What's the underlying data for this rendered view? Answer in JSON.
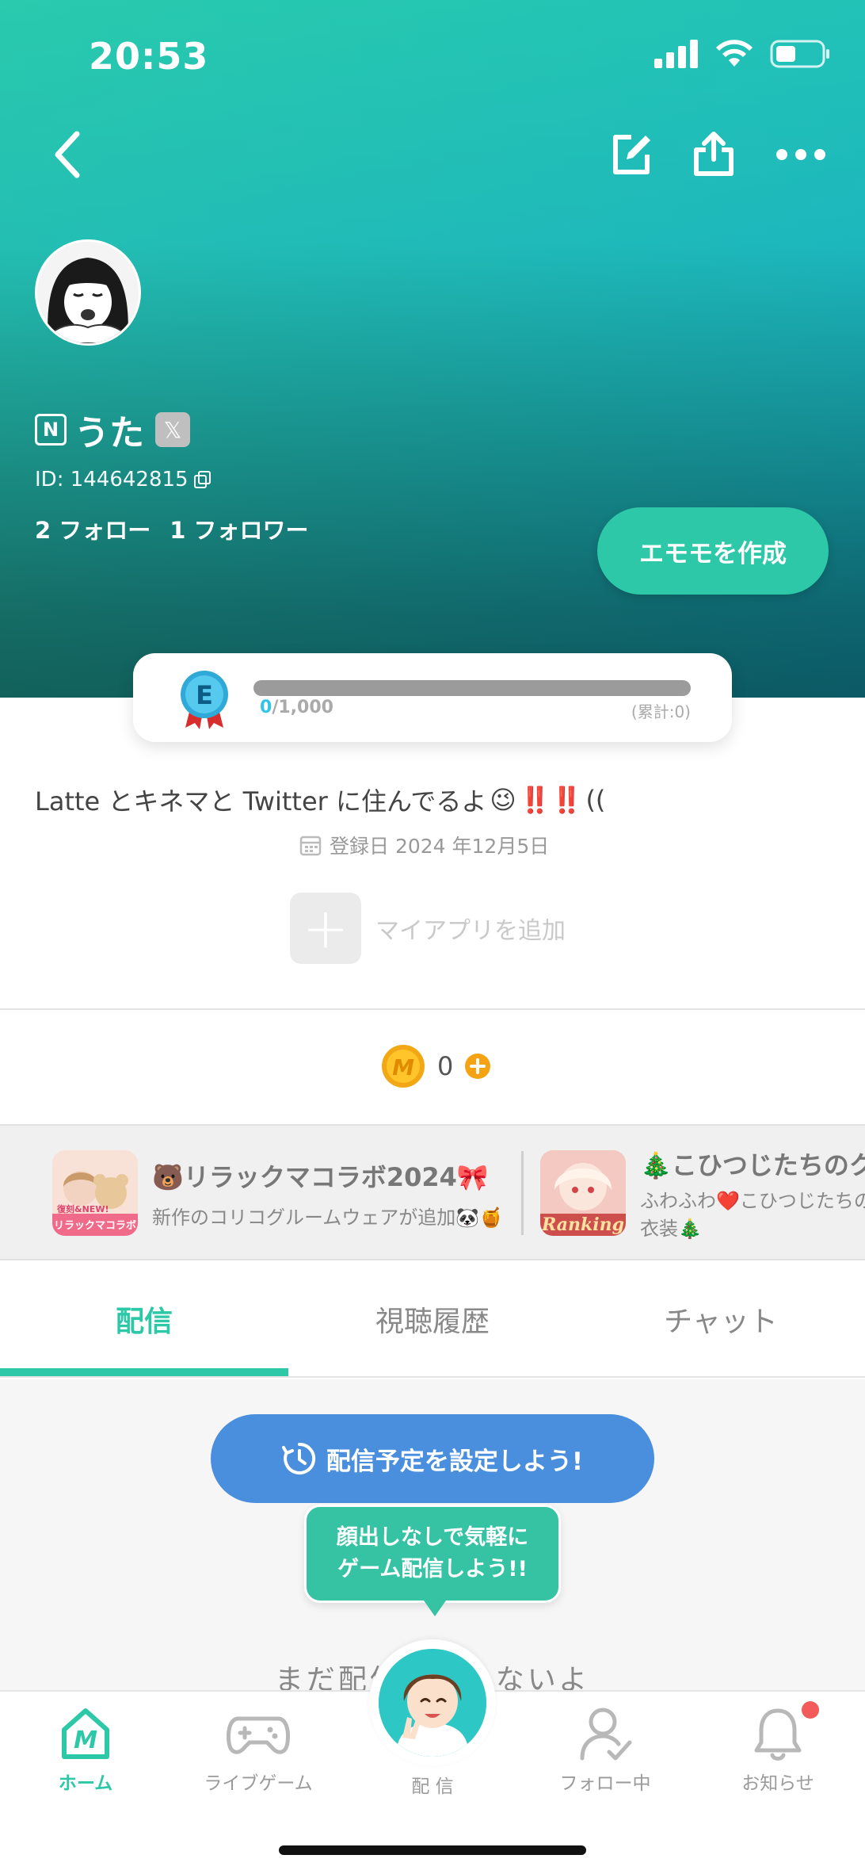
{
  "status_bar": {
    "time": "20:53"
  },
  "profile": {
    "name_badge": "N",
    "name": "うた",
    "x_badge": "𝕏",
    "id_label": "ID: 144642815",
    "following": "2 フォロー",
    "followers": "1 フォロワー",
    "emomo_button": "エモモを作成"
  },
  "level": {
    "medal_letter": "E",
    "current": "0",
    "max": "/1,000",
    "total": "(累計:0)",
    "progress_fraction": 0
  },
  "bio": {
    "text": "Latte とキネマと Twitter に住んでるよ",
    "emoji": "😉",
    "marks": "‼️‼️",
    "suffix": "((",
    "registered": "登録日 2024 年12月5日"
  },
  "my_app": {
    "label": "マイアプリを追加"
  },
  "coins": {
    "count": "0"
  },
  "banners": [
    {
      "title": "🐻リラックマコラボ2024🎀",
      "subtitle": "新作のコリコグルームウェアが追加🐼🍯",
      "thumb_text": "リラックマコラボ",
      "thumb_badge": "復刻&NEW!"
    },
    {
      "title": "🎄こひつじたちのク",
      "subtitle": "ふわふわ❤️こひつじたちの",
      "subtitle2": "衣装🎄",
      "thumb_text": "Ranking"
    }
  ],
  "tabs": [
    {
      "label": "配信",
      "active": true
    },
    {
      "label": "視聴履歴",
      "active": false
    },
    {
      "label": "チャット",
      "active": false
    }
  ],
  "content": {
    "schedule_button": "配信予定を設定しよう!",
    "tooltip_line1": "顔出しなしで気軽に",
    "tooltip_line2": "ゲーム配信しよう!!",
    "empty_text": "まだ配信していないよ"
  },
  "bottom_nav": {
    "home": "ホーム",
    "live_game": "ライブゲーム",
    "broadcast": "配 信",
    "following": "フォロー中",
    "notifications": "お知らせ"
  },
  "colors": {
    "accent": "#2dc8a7",
    "schedule_blue": "#4a8ede",
    "notification_red": "#f35a5a"
  }
}
